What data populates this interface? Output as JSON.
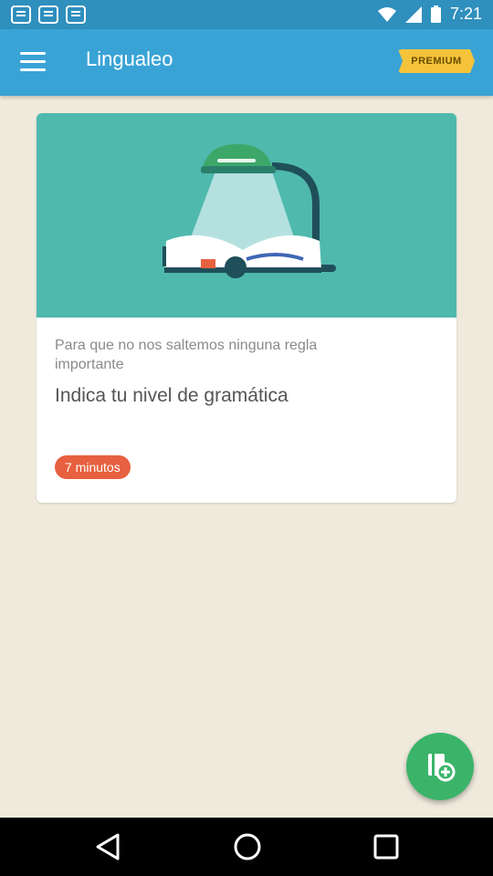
{
  "status_bar": {
    "time": "7:21",
    "icons": [
      "notification-icon",
      "notification-icon",
      "notification-icon",
      "wifi-icon",
      "signal-icon",
      "battery-icon"
    ]
  },
  "app_bar": {
    "title": "Lingualeo",
    "premium_label": "PREMIUM",
    "menu_icon": "menu-icon"
  },
  "card": {
    "subtitle": "Para que no nos saltemos ninguna regla importante",
    "title": "Indica tu nivel de gramática",
    "time_badge": "7 minutos",
    "illustration": "reading-lamp-book",
    "image_bg": "#4fb9ad"
  },
  "fab": {
    "icon": "add-to-dictionary-icon",
    "color": "#3bb46a"
  },
  "nav_bar": {
    "items": [
      "back-icon",
      "home-icon",
      "recents-icon"
    ]
  },
  "colors": {
    "app_bar": "#3aa3d6",
    "status_bar": "#2f8fbd",
    "background": "#efeadc",
    "premium": "#f4c33a",
    "badge": "#e7603f"
  }
}
